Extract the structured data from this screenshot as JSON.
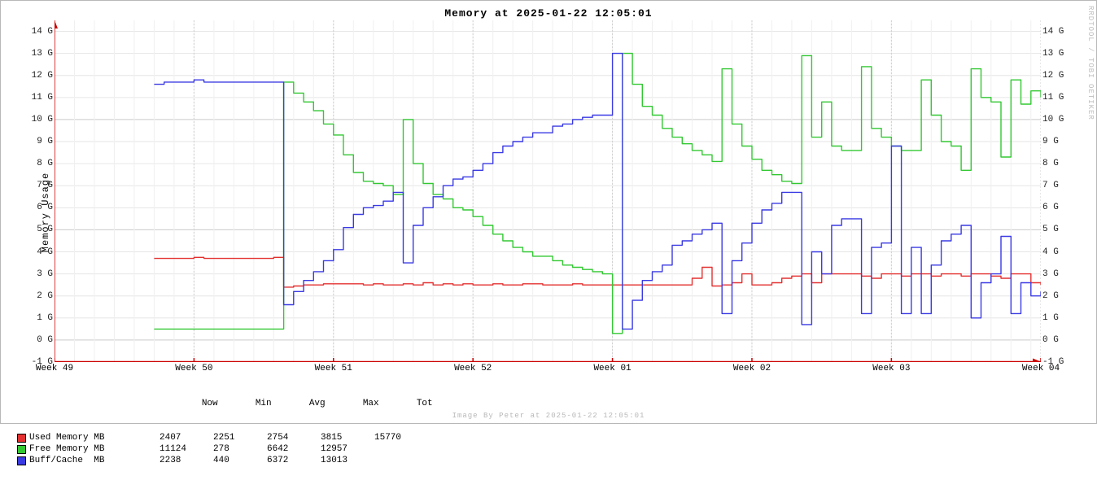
{
  "title": "Memory at 2025-01-22 12:05:01",
  "ylabel": "Memory Usage",
  "rrd_credit": "RRDTOOL / TOBI OETIKER",
  "footer_credit": "Image By Peter at 2025-01-22 12:05:01",
  "y_ticks": [
    "-1 G",
    "0 G",
    "1 G",
    "2 G",
    "3 G",
    "4 G",
    "5 G",
    "6 G",
    "7 G",
    "8 G",
    "9 G",
    "10 G",
    "11 G",
    "12 G",
    "13 G",
    "14 G"
  ],
  "x_ticks": [
    "Week 49",
    "Week 50",
    "Week 51",
    "Week 52",
    "Week 01",
    "Week 02",
    "Week 03",
    "Week 04"
  ],
  "legend_headers": [
    "Now",
    "Min",
    "Avg",
    "Max",
    "Tot"
  ],
  "legend": [
    {
      "color": "#e43030",
      "name": "Used Memory MB",
      "now": "2407",
      "min": "2251",
      "avg": "2754",
      "max": "3815",
      "tot": "15770"
    },
    {
      "color": "#32c832",
      "name": "Free Memory MB",
      "now": "11124",
      "min": "278",
      "avg": "6642",
      "max": "12957",
      "tot": ""
    },
    {
      "color": "#3a3ae4",
      "name": "Buff/Cache  MB",
      "now": "2238",
      "min": "440",
      "avg": "6372",
      "max": "13013",
      "tot": ""
    }
  ],
  "chart_data": {
    "type": "line",
    "title": "Memory at 2025-01-22 12:05:01",
    "xlabel": "",
    "ylabel": "Memory Usage",
    "ylim": [
      -1,
      14.5
    ],
    "categories": [
      "Week 49",
      "Week 50",
      "Week 51",
      "Week 52",
      "Week 01",
      "Week 02",
      "Week 03",
      "Week 04"
    ],
    "grid": true,
    "legend_position": "bottom-left",
    "x": [
      0,
      1,
      2,
      3,
      4,
      5,
      6,
      7,
      8,
      9,
      10,
      11,
      12,
      13,
      14,
      15,
      16,
      17,
      18,
      19,
      20,
      21,
      22,
      23,
      24,
      25,
      26,
      27,
      28,
      29,
      30,
      31,
      32,
      33,
      34,
      35,
      36,
      37,
      38,
      39,
      40,
      41,
      42,
      43,
      44,
      45,
      46,
      47,
      48,
      49,
      50,
      51,
      52,
      53,
      54,
      55,
      56,
      57,
      58,
      59,
      60,
      61,
      62,
      63,
      64,
      65,
      66,
      67,
      68,
      69,
      70,
      71,
      72,
      73,
      74,
      75,
      76,
      77,
      78,
      79,
      80,
      81,
      82,
      83,
      84,
      85,
      86,
      87,
      88,
      89,
      90,
      91,
      92,
      93,
      94,
      95,
      96,
      97,
      98,
      99
    ],
    "x_range": [
      0,
      99
    ],
    "x_category_positions": {
      "Week 49": 0,
      "Week 50": 14,
      "Week 51": 28,
      "Week 52": 42,
      "Week 01": 56,
      "Week 02": 70,
      "Week 03": 84,
      "Week 04": 99
    },
    "series": [
      {
        "name": "Used Memory MB",
        "color": "#e43030",
        "values": [
          null,
          null,
          null,
          null,
          null,
          null,
          null,
          null,
          null,
          null,
          3.7,
          3.7,
          3.7,
          3.7,
          3.75,
          3.7,
          3.7,
          3.7,
          3.7,
          3.7,
          3.7,
          3.7,
          3.75,
          2.4,
          2.45,
          2.5,
          2.5,
          2.55,
          2.55,
          2.55,
          2.55,
          2.5,
          2.55,
          2.5,
          2.5,
          2.55,
          2.5,
          2.6,
          2.5,
          2.55,
          2.5,
          2.55,
          2.5,
          2.5,
          2.55,
          2.5,
          2.5,
          2.55,
          2.55,
          2.5,
          2.5,
          2.5,
          2.55,
          2.5,
          2.5,
          2.5,
          2.5,
          2.5,
          2.5,
          2.5,
          2.5,
          2.5,
          2.5,
          2.5,
          2.8,
          3.3,
          2.45,
          2.5,
          2.6,
          3.0,
          2.5,
          2.5,
          2.6,
          2.8,
          2.9,
          3.0,
          2.6,
          3.0,
          3.0,
          3.0,
          3.0,
          2.9,
          2.8,
          3.0,
          3.0,
          2.9,
          3.0,
          3.0,
          2.9,
          3.0,
          3.0,
          2.9,
          3.0,
          3.0,
          2.9,
          2.8,
          3.0,
          3.0,
          2.6,
          2.5
        ]
      },
      {
        "name": "Free Memory MB",
        "color": "#32c832",
        "values": [
          null,
          null,
          null,
          null,
          null,
          null,
          null,
          null,
          null,
          null,
          0.5,
          0.5,
          0.5,
          0.5,
          0.5,
          0.5,
          0.5,
          0.5,
          0.5,
          0.5,
          0.5,
          0.5,
          0.5,
          11.7,
          11.2,
          10.8,
          10.4,
          9.8,
          9.3,
          8.4,
          7.6,
          7.2,
          7.1,
          7.0,
          6.6,
          10.0,
          8.0,
          7.1,
          6.6,
          6.4,
          6.0,
          5.9,
          5.6,
          5.2,
          4.8,
          4.5,
          4.2,
          4.0,
          3.8,
          3.8,
          3.6,
          3.4,
          3.3,
          3.2,
          3.1,
          3.0,
          0.3,
          13.0,
          11.6,
          10.6,
          10.2,
          9.6,
          9.2,
          8.9,
          8.6,
          8.4,
          8.1,
          12.3,
          9.8,
          8.8,
          8.2,
          7.7,
          7.5,
          7.2,
          7.1,
          12.9,
          9.2,
          10.8,
          8.8,
          8.6,
          8.6,
          12.4,
          9.6,
          9.2,
          8.8,
          8.6,
          8.6,
          11.8,
          10.2,
          9.0,
          8.8,
          7.7,
          12.3,
          11.0,
          10.8,
          8.3,
          11.8,
          10.7,
          11.3,
          11.0
        ]
      },
      {
        "name": "Buff/Cache MB",
        "color": "#3a3ae4",
        "values": [
          null,
          null,
          null,
          null,
          null,
          null,
          null,
          null,
          null,
          null,
          11.6,
          11.7,
          11.7,
          11.7,
          11.8,
          11.7,
          11.7,
          11.7,
          11.7,
          11.7,
          11.7,
          11.7,
          11.7,
          1.6,
          2.2,
          2.7,
          3.1,
          3.6,
          4.1,
          5.1,
          5.7,
          6.0,
          6.1,
          6.3,
          6.7,
          3.5,
          5.2,
          6.0,
          6.5,
          7.0,
          7.3,
          7.4,
          7.7,
          8.0,
          8.5,
          8.8,
          9.0,
          9.2,
          9.4,
          9.4,
          9.7,
          9.8,
          10.0,
          10.1,
          10.2,
          10.2,
          13.0,
          0.5,
          1.8,
          2.7,
          3.1,
          3.4,
          4.3,
          4.5,
          4.8,
          5.0,
          5.3,
          1.2,
          3.6,
          4.4,
          5.3,
          5.9,
          6.2,
          6.7,
          6.7,
          0.7,
          4.0,
          3.0,
          5.2,
          5.5,
          5.5,
          1.2,
          4.2,
          4.4,
          8.8,
          1.2,
          4.2,
          1.2,
          3.4,
          4.5,
          4.8,
          5.2,
          1.0,
          2.6,
          3.0,
          4.7,
          1.2,
          2.6,
          2.0,
          2.2
        ]
      }
    ]
  }
}
